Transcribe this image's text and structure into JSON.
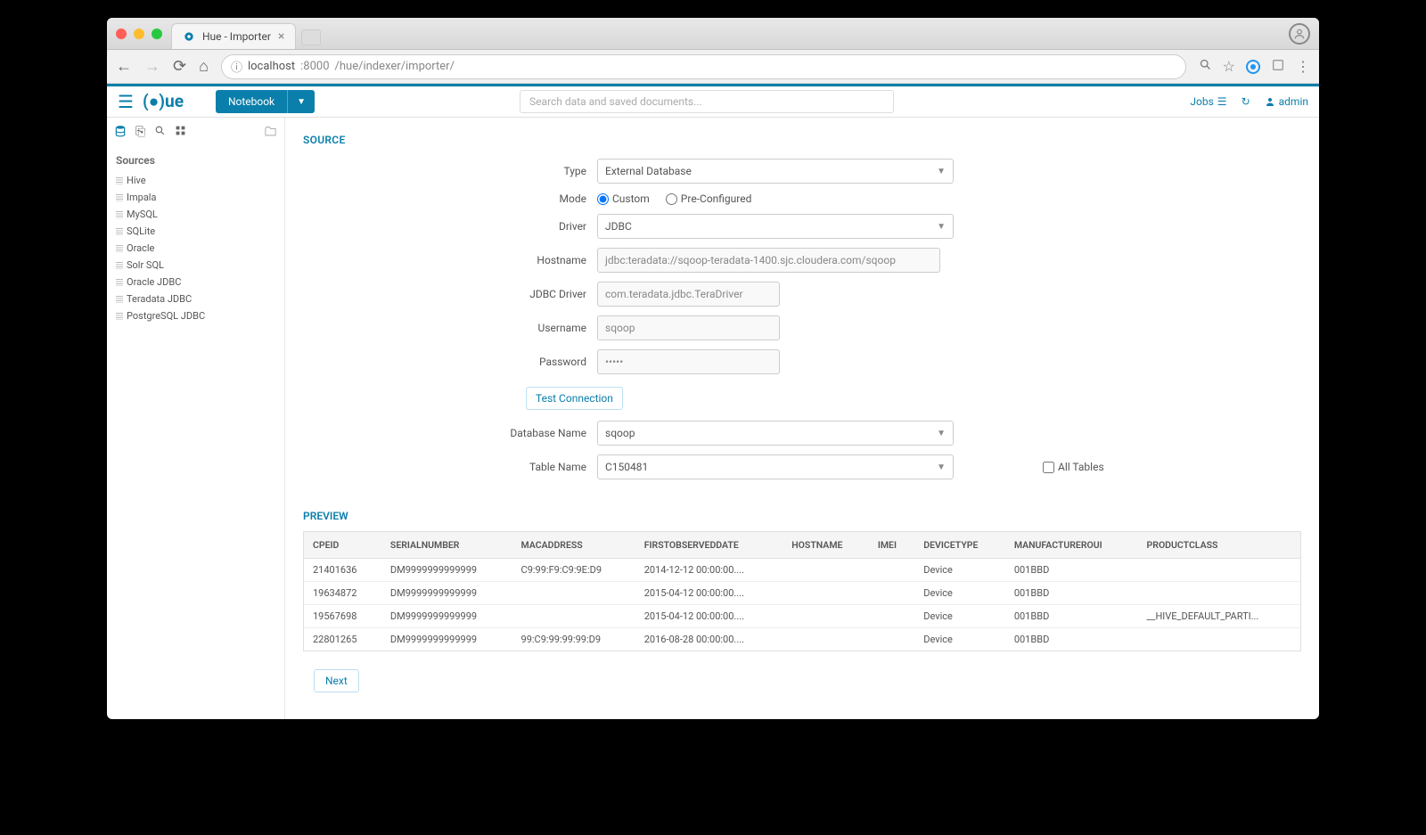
{
  "browser": {
    "tab_title": "Hue - Importer",
    "url_host": "localhost",
    "url_port": ":8000",
    "url_path": "/hue/indexer/importer/"
  },
  "huebar": {
    "notebook_label": "Notebook",
    "search_placeholder": "Search data and saved documents...",
    "jobs_label": "Jobs",
    "user_label": "admin"
  },
  "sidebar": {
    "header": "Sources",
    "items": [
      {
        "label": "Hive"
      },
      {
        "label": "Impala"
      },
      {
        "label": "MySQL"
      },
      {
        "label": "SQLite"
      },
      {
        "label": "Oracle"
      },
      {
        "label": "Solr SQL"
      },
      {
        "label": "Oracle JDBC"
      },
      {
        "label": "Teradata JDBC"
      },
      {
        "label": "PostgreSQL JDBC"
      }
    ]
  },
  "source": {
    "title": "SOURCE",
    "type_label": "Type",
    "type_value": "External Database",
    "mode_label": "Mode",
    "mode_custom": "Custom",
    "mode_preconfigured": "Pre-Configured",
    "driver_label": "Driver",
    "driver_value": "JDBC",
    "hostname_label": "Hostname",
    "hostname_value": "jdbc:teradata://sqoop-teradata-1400.sjc.cloudera.com/sqoop",
    "jdbc_driver_label": "JDBC Driver",
    "jdbc_driver_value": "com.teradata.jdbc.TeraDriver",
    "username_label": "Username",
    "username_value": "sqoop",
    "password_label": "Password",
    "password_value": "•••••",
    "test_connection": "Test Connection",
    "database_name_label": "Database Name",
    "database_name_value": "sqoop",
    "table_name_label": "Table Name",
    "table_name_value": "C150481",
    "all_tables_label": "All Tables"
  },
  "preview": {
    "title": "PREVIEW",
    "columns": [
      "CPEID",
      "SERIALNUMBER",
      "MACADDRESS",
      "FIRSTOBSERVEDDATE",
      "HOSTNAME",
      "IMEI",
      "DEVICETYPE",
      "MANUFACTUREROUI",
      "PRODUCTCLASS"
    ],
    "rows": [
      {
        "cpeid": "21401636",
        "serial": "DM9999999999999",
        "mac": "C9:99:F9:C9:9E:D9",
        "date": "2014-12-12 00:00:00....",
        "host": "",
        "imei": "",
        "type": "Device",
        "oui": "001BBD",
        "product": ""
      },
      {
        "cpeid": "19634872",
        "serial": "DM9999999999999",
        "mac": "",
        "date": "2015-04-12 00:00:00....",
        "host": "",
        "imei": "",
        "type": "Device",
        "oui": "001BBD",
        "product": ""
      },
      {
        "cpeid": "19567698",
        "serial": "DM9999999999999",
        "mac": "",
        "date": "2015-04-12 00:00:00....",
        "host": "",
        "imei": "",
        "type": "Device",
        "oui": "001BBD",
        "product": "__HIVE_DEFAULT_PARTI..."
      },
      {
        "cpeid": "22801265",
        "serial": "DM9999999999999",
        "mac": "99:C9:99:99:99:D9",
        "date": "2016-08-28 00:00:00....",
        "host": "",
        "imei": "",
        "type": "Device",
        "oui": "001BBD",
        "product": ""
      }
    ]
  },
  "next_label": "Next"
}
